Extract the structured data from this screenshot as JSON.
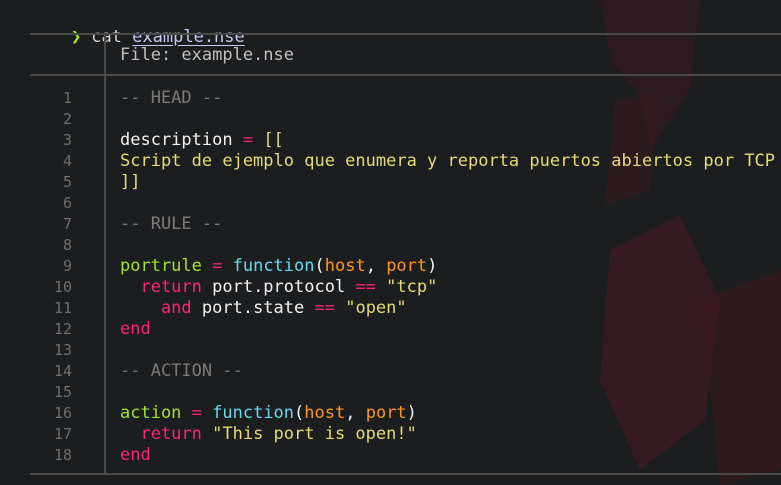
{
  "prompt": {
    "symbol": "❯",
    "command": "cat",
    "argument": "example.nse"
  },
  "file_header": "File: example.nse",
  "colors": {
    "background": "#1c1d1f",
    "prompt_symbol": "#a6e22e",
    "comment": "#7a7a7a",
    "keyword_operator": "#f92672",
    "string": "#e6db74",
    "function_name": "#a6e22e",
    "function_keyword": "#66d9ef",
    "parameter": "#fd971f",
    "line_number": "#6e6e6e",
    "border": "#4a4a4a"
  },
  "line_numbers": [
    "1",
    "2",
    "3",
    "4",
    "5",
    "6",
    "7",
    "8",
    "9",
    "10",
    "11",
    "12",
    "13",
    "14",
    "15",
    "16",
    "17",
    "18"
  ],
  "lines": [
    [
      {
        "t": "-- HEAD --",
        "c": "com"
      }
    ],
    [],
    [
      {
        "t": "description",
        "c": "id"
      },
      {
        "t": " = ",
        "c": "op"
      },
      {
        "t": "[[",
        "c": "str"
      }
    ],
    [
      {
        "t": "Script de ejemplo que enumera y reporta puertos abiertos por TCP",
        "c": "str"
      }
    ],
    [
      {
        "t": "]]",
        "c": "str"
      }
    ],
    [],
    [
      {
        "t": "-- RULE --",
        "c": "com"
      }
    ],
    [],
    [
      {
        "t": "portrule",
        "c": "name"
      },
      {
        "t": " = ",
        "c": "op"
      },
      {
        "t": "function",
        "c": "fn"
      },
      {
        "t": "(",
        "c": "pun"
      },
      {
        "t": "host",
        "c": "par"
      },
      {
        "t": ", ",
        "c": "pun"
      },
      {
        "t": "port",
        "c": "par"
      },
      {
        "t": ")",
        "c": "pun"
      }
    ],
    [
      {
        "t": "  return",
        "c": "kw"
      },
      {
        "t": " port.protocol ",
        "c": "id"
      },
      {
        "t": "==",
        "c": "op"
      },
      {
        "t": " ",
        "c": "id"
      },
      {
        "t": "\"tcp\"",
        "c": "str"
      }
    ],
    [
      {
        "t": "    and",
        "c": "kw"
      },
      {
        "t": " port.state ",
        "c": "id"
      },
      {
        "t": "==",
        "c": "op"
      },
      {
        "t": " ",
        "c": "id"
      },
      {
        "t": "\"open\"",
        "c": "str"
      }
    ],
    [
      {
        "t": "end",
        "c": "kw"
      }
    ],
    [],
    [
      {
        "t": "-- ACTION --",
        "c": "com"
      }
    ],
    [],
    [
      {
        "t": "action",
        "c": "name"
      },
      {
        "t": " = ",
        "c": "op"
      },
      {
        "t": "function",
        "c": "fn"
      },
      {
        "t": "(",
        "c": "pun"
      },
      {
        "t": "host",
        "c": "par"
      },
      {
        "t": ", ",
        "c": "pun"
      },
      {
        "t": "port",
        "c": "par"
      },
      {
        "t": ")",
        "c": "pun"
      }
    ],
    [
      {
        "t": "  return",
        "c": "kw"
      },
      {
        "t": " ",
        "c": "id"
      },
      {
        "t": "\"This port is open!\"",
        "c": "str"
      }
    ],
    [
      {
        "t": "end",
        "c": "kw"
      }
    ]
  ]
}
